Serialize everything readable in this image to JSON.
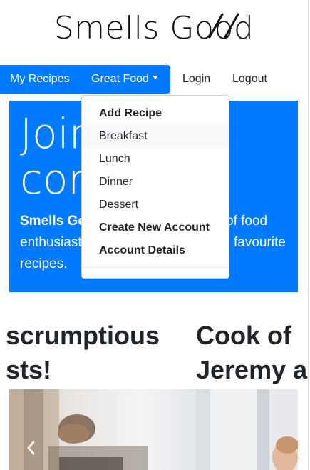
{
  "logo": {
    "text": "Smells Good"
  },
  "nav": {
    "my_recipes": "My Recipes",
    "great_food": "Great Food",
    "login": "Login",
    "logout": "Logout"
  },
  "hero": {
    "heading_line1": "Join",
    "heading_line2": "com",
    "lead_brand": "Smells Go",
    "lead_rest1": "of food",
    "lead_line2a": "enthusiast",
    "lead_line2b": "favourite",
    "lead_line3": "recipes."
  },
  "dropdown": {
    "items": [
      {
        "label": "Add Recipe",
        "bold": true
      },
      {
        "label": "Breakfast",
        "bold": false
      },
      {
        "label": "Lunch",
        "bold": false
      },
      {
        "label": "Dinner",
        "bold": false
      },
      {
        "label": "Dessert",
        "bold": false
      },
      {
        "label": "Create New Account",
        "bold": true
      },
      {
        "label": "Account Details",
        "bold": true
      }
    ]
  },
  "carousel": {
    "slide1_line1": "scrumptious",
    "slide1_line2": "sts!",
    "slide2_line1": "Cook of",
    "slide2_line2": "Jeremy a"
  },
  "colors": {
    "primary": "#007bff"
  }
}
